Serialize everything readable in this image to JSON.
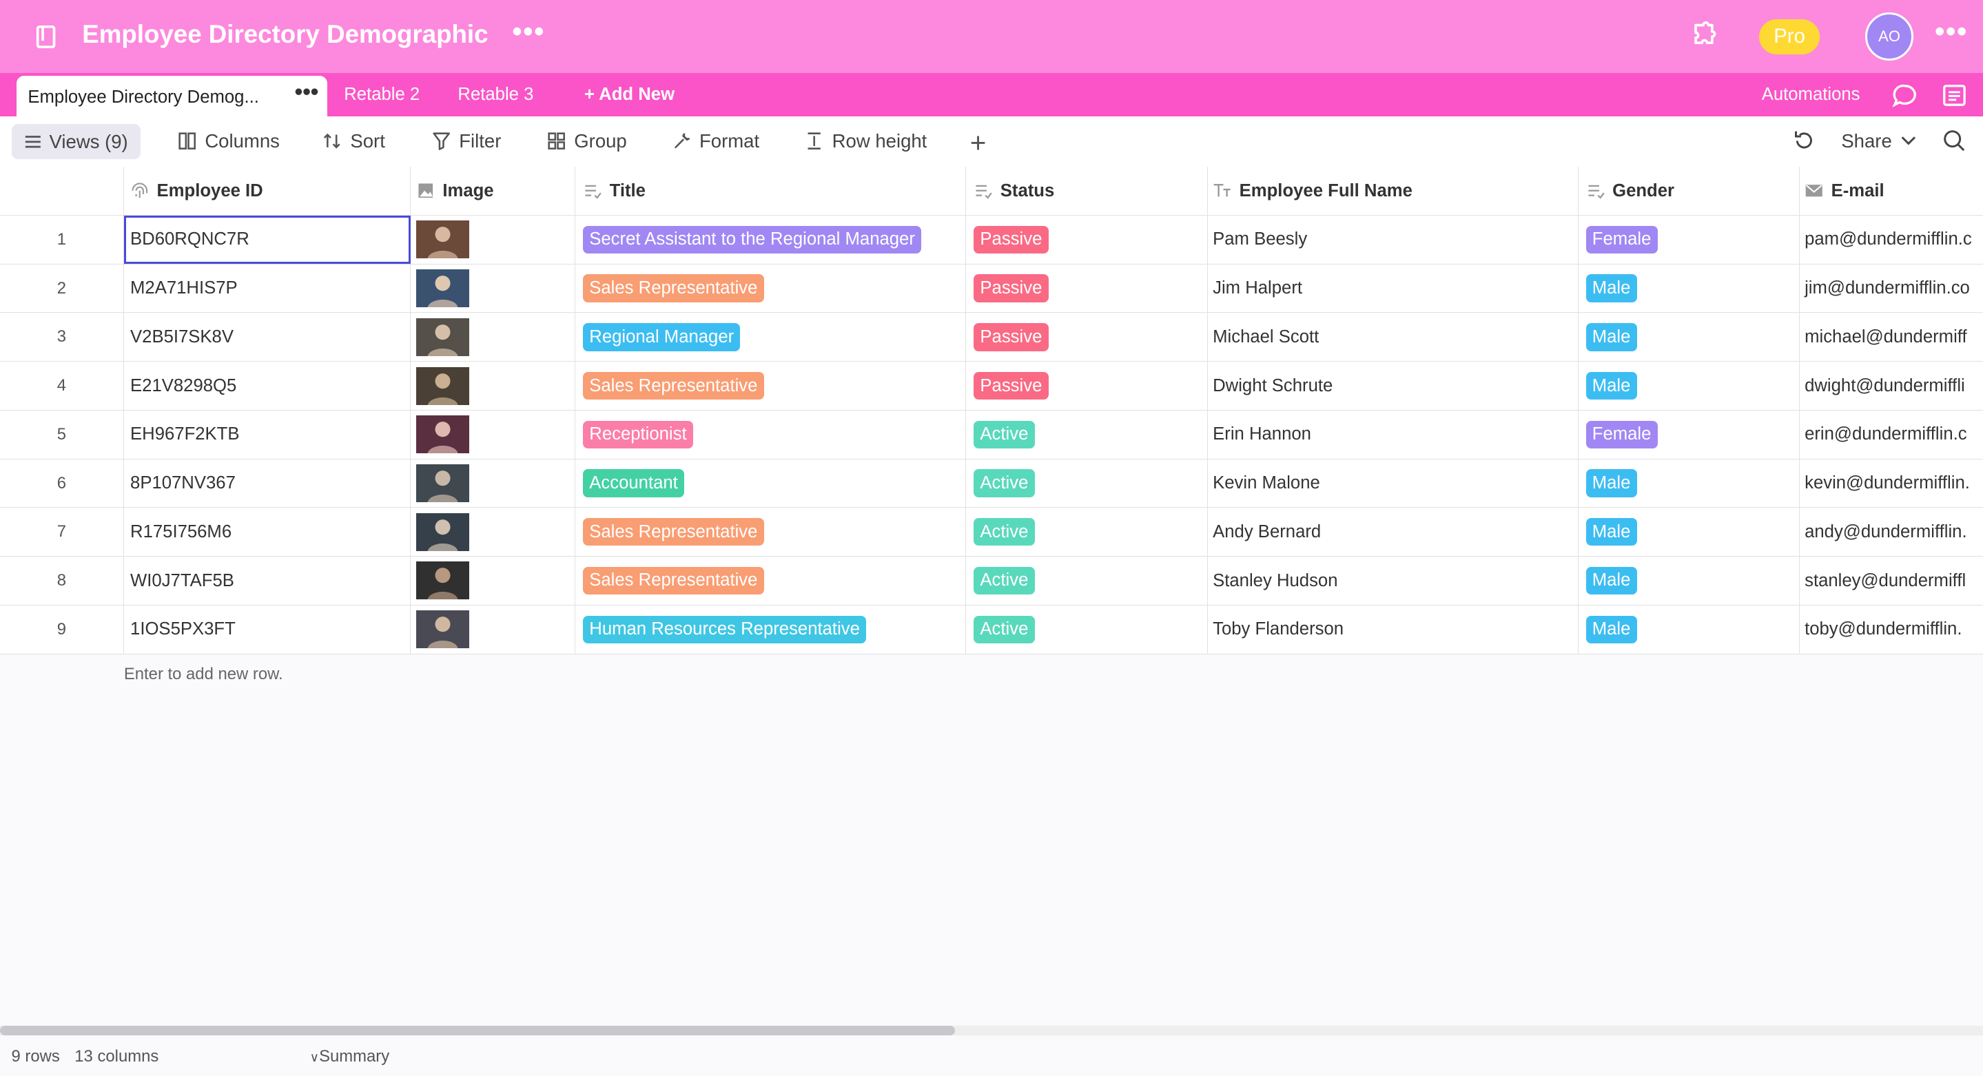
{
  "header": {
    "title": "Employee Directory Demographic",
    "plan_badge": "Pro",
    "avatar_initials": "AO",
    "background": "#fc89dd"
  },
  "tabs": {
    "items": [
      {
        "label": "Employee Directory Demog...",
        "active": true
      },
      {
        "label": "Retable 2"
      },
      {
        "label": "Retable 3"
      }
    ],
    "add_new": "Add New",
    "automations": "Automations"
  },
  "toolbar": {
    "views": "Views (9)",
    "columns": "Columns",
    "sort": "Sort",
    "filter": "Filter",
    "group": "Group",
    "format": "Format",
    "row_height": "Row height",
    "share": "Share"
  },
  "table": {
    "headers": [
      "Employee ID",
      "Image",
      "Title",
      "Status",
      "Employee Full Name",
      "Gender",
      "E-mail"
    ],
    "rows": [
      {
        "n": "1",
        "id": "BD60RQNC7R",
        "title": "Secret Assistant to the Regional Manager",
        "title_color": "#a187f4",
        "status": "Passive",
        "status_color": "#fa6a84",
        "name": "Pam Beesly",
        "gender": "Female",
        "gender_color": "#a187f4",
        "email": "pam@dundermifflin.c"
      },
      {
        "n": "2",
        "id": "M2A71HIS7P",
        "title": "Sales Representative",
        "title_color": "#f99d73",
        "status": "Passive",
        "status_color": "#fa6a84",
        "name": "Jim Halpert",
        "gender": "Male",
        "gender_color": "#3cbdf2",
        "email": "jim@dundermifflin.co"
      },
      {
        "n": "3",
        "id": "V2B5I7SK8V",
        "title": "Regional Manager",
        "title_color": "#3cbdf2",
        "status": "Passive",
        "status_color": "#fa6a84",
        "name": "Michael Scott",
        "gender": "Male",
        "gender_color": "#3cbdf2",
        "email": "michael@dundermiff"
      },
      {
        "n": "4",
        "id": "E21V8298Q5",
        "title": "Sales Representative",
        "title_color": "#f99d73",
        "status": "Passive",
        "status_color": "#fa6a84",
        "name": "Dwight Schrute",
        "gender": "Male",
        "gender_color": "#3cbdf2",
        "email": "dwight@dundermiffli"
      },
      {
        "n": "5",
        "id": "EH967F2KTB",
        "title": "Receptionist",
        "title_color": "#fb7ea8",
        "status": "Active",
        "status_color": "#59d9bb",
        "name": "Erin Hannon",
        "gender": "Female",
        "gender_color": "#a187f4",
        "email": "erin@dundermifflin.c"
      },
      {
        "n": "6",
        "id": "8P107NV367",
        "title": "Accountant",
        "title_color": "#43d1a4",
        "status": "Active",
        "status_color": "#59d9bb",
        "name": "Kevin Malone",
        "gender": "Male",
        "gender_color": "#3cbdf2",
        "email": "kevin@dundermifflin."
      },
      {
        "n": "7",
        "id": "R175I756M6",
        "title": "Sales Representative",
        "title_color": "#f99d73",
        "status": "Active",
        "status_color": "#59d9bb",
        "name": "Andy Bernard",
        "gender": "Male",
        "gender_color": "#3cbdf2",
        "email": "andy@dundermifflin."
      },
      {
        "n": "8",
        "id": "WI0J7TAF5B",
        "title": "Sales Representative",
        "title_color": "#f99d73",
        "status": "Active",
        "status_color": "#59d9bb",
        "name": "Stanley Hudson",
        "gender": "Male",
        "gender_color": "#3cbdf2",
        "email": "stanley@dundermiffl"
      },
      {
        "n": "9",
        "id": "1IOS5PX3FT",
        "title": "Human Resources Representative",
        "title_color": "#3fc6e4",
        "status": "Active",
        "status_color": "#59d9bb",
        "name": "Toby Flanderson",
        "gender": "Male",
        "gender_color": "#3cbdf2",
        "email": "toby@dundermifflin."
      }
    ],
    "add_row_hint": "Enter to add new row."
  },
  "footer": {
    "rows": "9 rows",
    "columns": "13 columns",
    "summary": "Summary"
  },
  "icons": [
    "book-icon",
    "more-icon",
    "puzzle-icon",
    "plus-icon",
    "chat-icon",
    "document-icon",
    "menu-icon",
    "columns-icon",
    "sort-icon",
    "filter-icon",
    "group-icon",
    "format-icon",
    "row-height-icon",
    "refresh-icon",
    "chevron-down-icon",
    "search-icon",
    "fingerprint-icon",
    "image-icon",
    "select-icon",
    "text-icon",
    "mail-icon"
  ]
}
